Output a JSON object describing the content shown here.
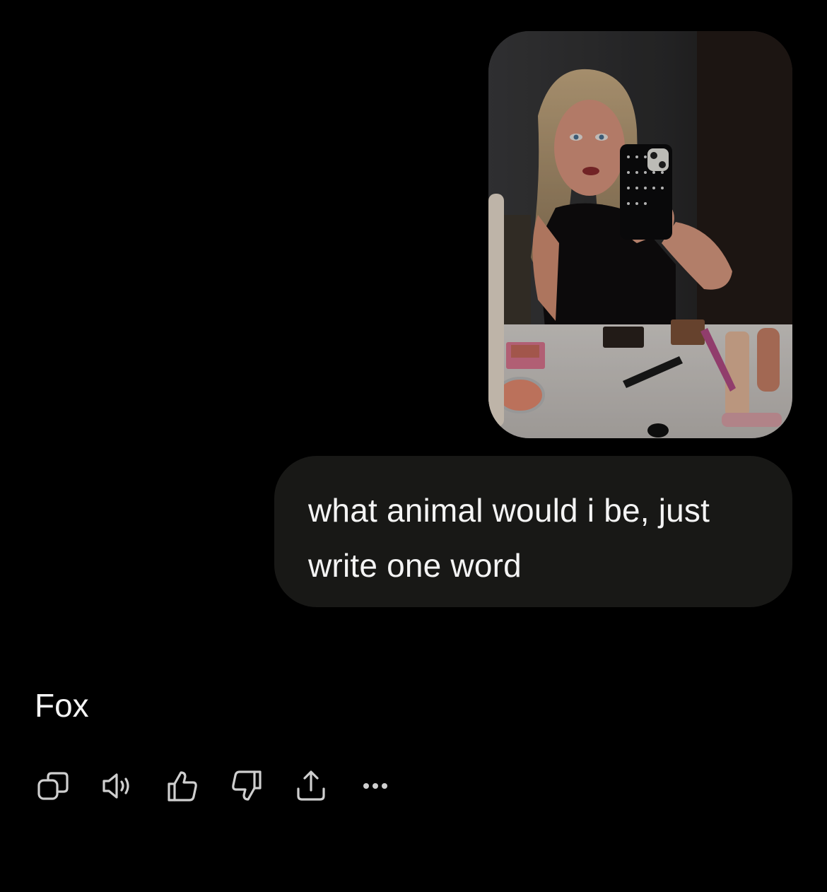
{
  "theme": {
    "background": "#000000",
    "user_bubble": "#181816",
    "text": "#f4f4f4",
    "icon": "#cfcfcf"
  },
  "conversation": {
    "user_message": {
      "attachment": {
        "type": "image",
        "depicts": "mirror-selfie-photo"
      },
      "text": "what animal would i be, just write one word"
    },
    "assistant_message": {
      "text": "Fox",
      "actions": [
        {
          "icon": "copy-icon"
        },
        {
          "icon": "speaker-icon"
        },
        {
          "icon": "thumbs-up-icon"
        },
        {
          "icon": "thumbs-down-icon"
        },
        {
          "icon": "share-icon"
        },
        {
          "icon": "more-icon"
        }
      ]
    }
  }
}
